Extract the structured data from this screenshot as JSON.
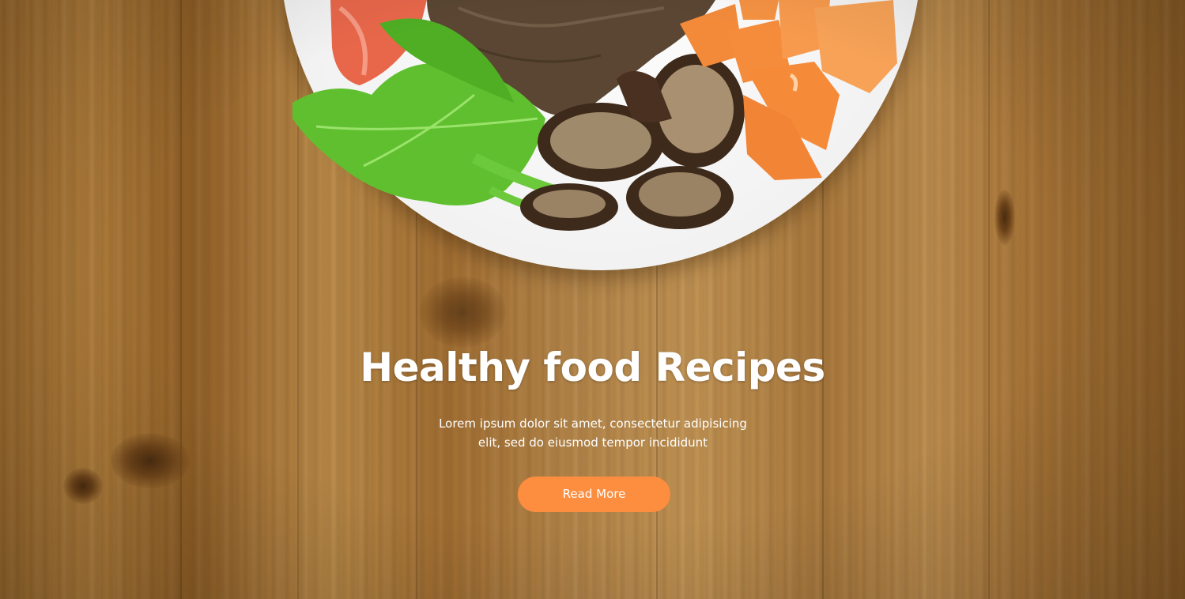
{
  "hero": {
    "title": "Healthy food Recipes",
    "subtitle_line1": "Lorem ipsum dolor sit amet, consectetur adipisicing",
    "subtitle_line2": "elit, sed do eiusmod tempor incididunt",
    "button_label": "Read More"
  },
  "colors": {
    "button": "#fd8d3f",
    "text": "#ffffff",
    "wood": "#b07e3c",
    "plate": "#ffffff"
  },
  "images": {
    "background": "wooden-table-photo",
    "plate": "plate-with-meat-mushrooms-celery-squash"
  }
}
